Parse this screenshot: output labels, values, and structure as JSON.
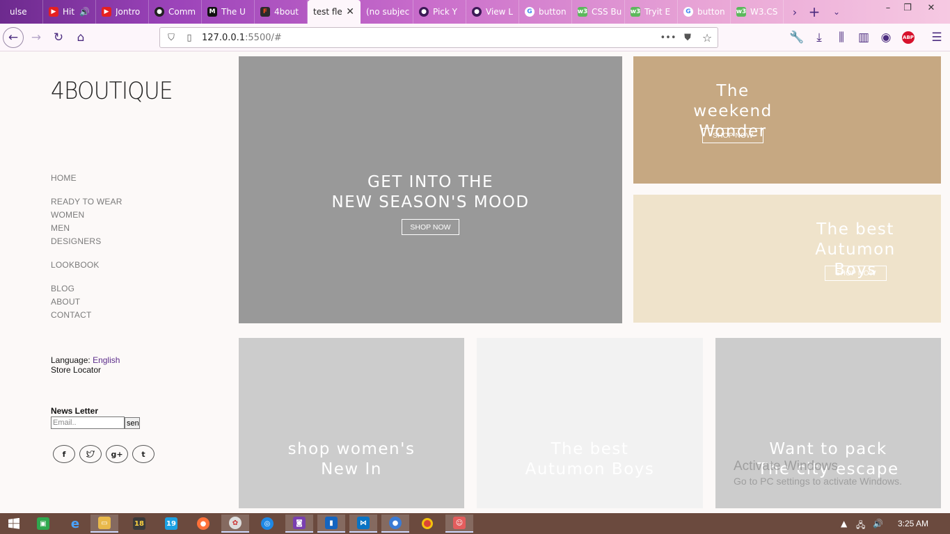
{
  "browser": {
    "tabs": [
      {
        "title": "ulse",
        "fav_color": "#7b3fb3",
        "fav_glyph": ""
      },
      {
        "title": "Hit",
        "fav_color": "#e52020",
        "fav_glyph": "▶"
      },
      {
        "title": "Jontro",
        "fav_color": "#e52020",
        "fav_glyph": "▶"
      },
      {
        "title": "Comm",
        "fav_color": "#222222",
        "fav_glyph": "●"
      },
      {
        "title": "The U",
        "fav_color": "#111111",
        "fav_glyph": "M"
      },
      {
        "title": "4bout",
        "fav_color": "#2b2b2b",
        "fav_glyph": "F"
      },
      {
        "title": "test fle",
        "fav_color": "",
        "fav_glyph": ""
      },
      {
        "title": "(no subjec",
        "fav_color": "",
        "fav_glyph": ""
      },
      {
        "title": "Pick Y",
        "fav_color": "#3d1a57",
        "fav_glyph": "●"
      },
      {
        "title": "View L",
        "fav_color": "#3d1a57",
        "fav_glyph": "●"
      },
      {
        "title": "button",
        "fav_color": "#ffffff",
        "fav_glyph": "G"
      },
      {
        "title": "CSS Bu",
        "fav_color": "#5cb85c",
        "fav_glyph": "w3"
      },
      {
        "title": "Tryit E",
        "fav_color": "#5cb85c",
        "fav_glyph": "w3"
      },
      {
        "title": "button",
        "fav_color": "#ffffff",
        "fav_glyph": "G"
      },
      {
        "title": "W3.CS",
        "fav_color": "#5cb85c",
        "fav_glyph": "w3"
      }
    ],
    "url_host": "127.0.0.1",
    "url_rest": ":5500/#"
  },
  "sidebar": {
    "logo": "4BOUTIQUE",
    "menu": [
      "HOME",
      "READY TO WEAR",
      "WOMEN",
      "MEN",
      "DESIGNERS",
      "LOOKBOOK",
      "BLOG",
      "ABOUT",
      "CONTACT"
    ],
    "language_label": "Language:",
    "language_value": "English",
    "store_locator": "Store Locator",
    "newsletter_title": "News Letter",
    "newsletter_placeholder": "Email..",
    "newsletter_button": "sen",
    "social": [
      "f",
      "t",
      "g+",
      "t"
    ]
  },
  "tiles": {
    "main": {
      "line1": "GET INTO THE",
      "line2": "NEW SEASON'S MOOD",
      "button": "SHOP NOW",
      "bg": "#999999"
    },
    "weekend": {
      "line1": "The weekend",
      "line2": "Wonder",
      "button": "SHOP NOW",
      "bg": "#c6a882"
    },
    "autumn_top": {
      "line1": "The best",
      "line2": "Autumon Boys",
      "button": "SHOP NOW",
      "bg": "#efe3cb"
    },
    "women": {
      "line1": "shop women's",
      "line2": "New In",
      "bg": "#cccccc"
    },
    "autumn_bottom": {
      "line1": "The best",
      "line2": "Autumon Boys",
      "bg": "#f2f2f2"
    },
    "city": {
      "line1": "Want to pack",
      "line2": "The city escape",
      "bg": "#cccccc"
    }
  },
  "watermark": {
    "line1": "Activate Windows",
    "line2": "Go to PC settings to activate Windows."
  },
  "taskbar": {
    "clock": "3:25 AM",
    "badge18": "18",
    "badge19": "19"
  }
}
